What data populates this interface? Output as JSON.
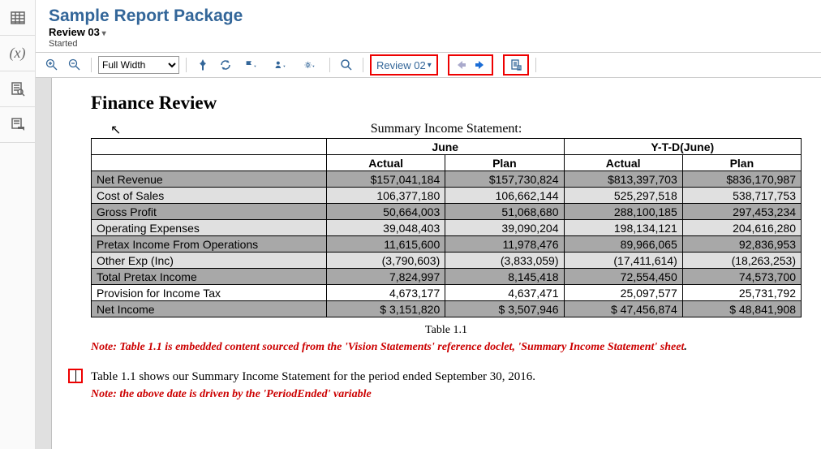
{
  "sidebar": {
    "items": [
      "sheet-icon",
      "variable-icon",
      "inspect-icon",
      "comment-icon"
    ]
  },
  "header": {
    "title": "Sample Report Package",
    "subtitle": "Review 03",
    "status": "Started"
  },
  "toolbar": {
    "zoom_mode": "Full Width",
    "review_dropdown": "Review 02"
  },
  "doc": {
    "heading": "Finance Review",
    "table_title": "Summary Income Statement:",
    "caption": "Table 1.1",
    "note1": "Note: Table 1.1 is embedded content sourced from the 'Vision Statements' reference doclet, 'Summary Income Statement' sheet",
    "note1_end": ".",
    "para": "Table 1.1 shows our Summary Income Statement for the period ended September 30, 2016.",
    "note2": "Note: the above date is driven by the 'PeriodEnded' variable"
  },
  "table": {
    "group_headers": [
      "June",
      "Y-T-D(June)"
    ],
    "col_headers": [
      "Actual",
      "Plan",
      "Actual",
      "Plan"
    ],
    "rows": [
      {
        "label": "Net Revenue",
        "vals": [
          "$157,041,184",
          "$157,730,824",
          "$813,397,703",
          "$836,170,987"
        ],
        "shade": "dark"
      },
      {
        "label": "Cost of Sales",
        "vals": [
          "106,377,180",
          "106,662,144",
          "525,297,518",
          "538,717,753"
        ],
        "shade": "light"
      },
      {
        "label": "Gross Profit",
        "vals": [
          "50,664,003",
          "51,068,680",
          "288,100,185",
          "297,453,234"
        ],
        "shade": "dark"
      },
      {
        "label": "Operating Expenses",
        "vals": [
          "39,048,403",
          "39,090,204",
          "198,134,121",
          "204,616,280"
        ],
        "shade": "light"
      },
      {
        "label": "Pretax Income From Operations",
        "vals": [
          "11,615,600",
          "11,978,476",
          "89,966,065",
          "92,836,953"
        ],
        "shade": "dark"
      },
      {
        "label": "Other Exp (Inc)",
        "vals": [
          "(3,790,603)",
          "(3,833,059)",
          "(17,411,614)",
          "(18,263,253)"
        ],
        "shade": "light"
      },
      {
        "label": "Total Pretax Income",
        "vals": [
          "7,824,997",
          "8,145,418",
          "72,554,450",
          "74,573,700"
        ],
        "shade": "dark"
      },
      {
        "label": "Provision for Income Tax",
        "vals": [
          "4,673,177",
          "4,637,471",
          "25,097,577",
          "25,731,792"
        ],
        "shade": "white"
      },
      {
        "label": "Net Income",
        "vals": [
          "$  3,151,820",
          "$  3,507,946",
          "$ 47,456,874",
          "$ 48,841,908"
        ],
        "shade": "dark"
      }
    ]
  },
  "chart_data": {
    "type": "table",
    "title": "Summary Income Statement:",
    "column_groups": [
      "June",
      "Y-T-D(June)"
    ],
    "columns": [
      "Actual",
      "Plan",
      "Actual",
      "Plan"
    ],
    "rows": [
      {
        "label": "Net Revenue",
        "values": [
          157041184,
          157730824,
          813397703,
          836170987
        ]
      },
      {
        "label": "Cost of Sales",
        "values": [
          106377180,
          106662144,
          525297518,
          538717753
        ]
      },
      {
        "label": "Gross Profit",
        "values": [
          50664003,
          51068680,
          288100185,
          297453234
        ]
      },
      {
        "label": "Operating Expenses",
        "values": [
          39048403,
          39090204,
          198134121,
          204616280
        ]
      },
      {
        "label": "Pretax Income From Operations",
        "values": [
          11615600,
          11978476,
          89966065,
          92836953
        ]
      },
      {
        "label": "Other Exp (Inc)",
        "values": [
          -3790603,
          -3833059,
          -17411614,
          -18263253
        ]
      },
      {
        "label": "Total Pretax Income",
        "values": [
          7824997,
          8145418,
          72554450,
          74573700
        ]
      },
      {
        "label": "Provision for Income Tax",
        "values": [
          4673177,
          4637471,
          25097577,
          25731792
        ]
      },
      {
        "label": "Net Income",
        "values": [
          3151820,
          3507946,
          47456874,
          48841908
        ]
      }
    ]
  }
}
